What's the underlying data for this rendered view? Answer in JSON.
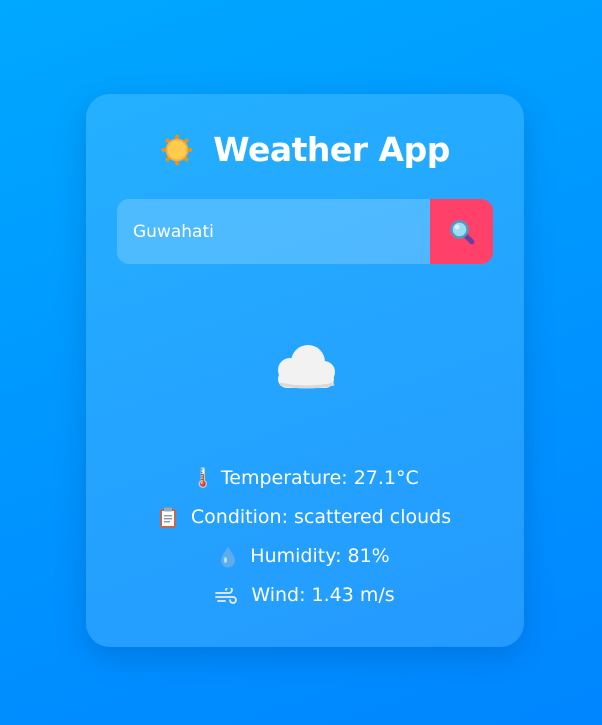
{
  "app": {
    "title": "Weather App",
    "title_icon": "sun-icon"
  },
  "search": {
    "value": "Guwahati",
    "button_icon": "magnifier-icon"
  },
  "weather": {
    "icon": "cloud-icon",
    "temperature": "🌡️ Temperature: 27.1°C",
    "condition": "Condition: scattered clouds",
    "humidity": "Humidity: 81%",
    "wind": "Wind: 1.43 m/s"
  },
  "detail_icons": {
    "temperature": "thermometer-icon",
    "condition": "clipboard-icon",
    "humidity": "droplet-icon",
    "wind": "wind-icon"
  },
  "colors": {
    "background": "#0096ff",
    "accent": "#ff4169",
    "text": "#ffffff"
  }
}
